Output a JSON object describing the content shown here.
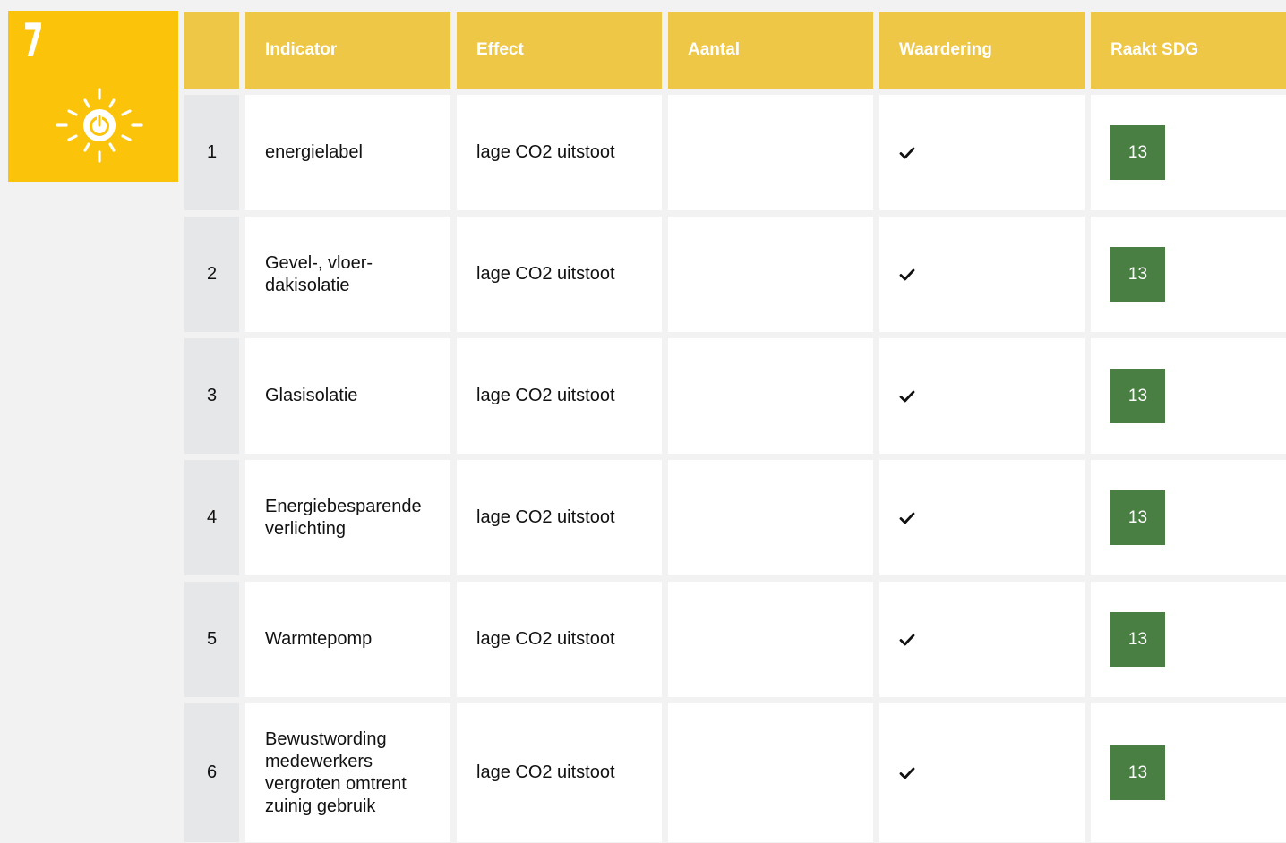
{
  "goal": {
    "number": "7",
    "icon": "sun-power-icon",
    "color": "#fcc30b"
  },
  "table": {
    "headers": [
      "",
      "Indicator",
      "Effect",
      "Aantal",
      "Waardering",
      "Raakt SDG"
    ],
    "rows": [
      {
        "num": "1",
        "indicator": "energielabel",
        "effect": "lage CO2 uitstoot",
        "aantal": "",
        "waardering": "check-icon",
        "sdg": "13"
      },
      {
        "num": "2",
        "indicator": "Gevel-, vloer-\ndakisolatie",
        "effect": "lage CO2 uitstoot",
        "aantal": "",
        "waardering": "check-icon",
        "sdg": "13"
      },
      {
        "num": "3",
        "indicator": "Glasisolatie",
        "effect": "lage CO2 uitstoot",
        "aantal": "",
        "waardering": "check-icon",
        "sdg": "13"
      },
      {
        "num": "4",
        "indicator": "Energiebesparende\nverlichting",
        "effect": "lage CO2 uitstoot",
        "aantal": "",
        "waardering": "check-icon",
        "sdg": "13"
      },
      {
        "num": "5",
        "indicator": "Warmtepomp",
        "effect": "lage CO2 uitstoot",
        "aantal": "",
        "waardering": "check-icon",
        "sdg": "13"
      },
      {
        "num": "6",
        "indicator": "Bewustwording\nmedewerkers\nvergroten omtrent\nzuinig gebruik",
        "effect": "lage CO2 uitstoot",
        "aantal": "",
        "waardering": "check-icon",
        "sdg": "13"
      }
    ]
  },
  "colors": {
    "header": "#eec746",
    "sdg_badge": "#4a7f44",
    "number_cell": "#e6e7e9"
  }
}
